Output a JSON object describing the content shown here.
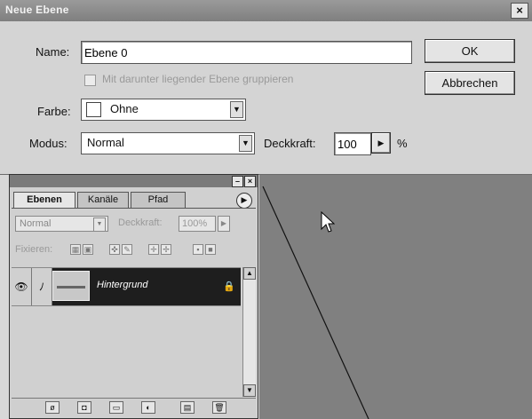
{
  "dialog": {
    "title": "Neue Ebene",
    "close_glyph": "×",
    "name_label": "Name:",
    "name_value": "Ebene 0",
    "group_checkbox_label": "Mit darunter liegender Ebene gruppieren",
    "color_label": "Farbe:",
    "color_value": "Ohne",
    "mode_label": "Modus:",
    "mode_value": "Normal",
    "opacity_label": "Deckkraft:",
    "opacity_value": "100",
    "opacity_unit": "%",
    "ok_label": "OK",
    "cancel_label": "Abbrechen"
  },
  "palette": {
    "tabs": [
      {
        "label": "Ebenen",
        "active": true
      },
      {
        "label": "Kanäle",
        "active": false
      },
      {
        "label": "Pfad",
        "active": false
      }
    ],
    "blend_mode": "Normal",
    "opacity_label": "Deckkraft:",
    "opacity_value": "100%",
    "lock_label": "Fixieren:",
    "layer": {
      "name": "Hintergrund"
    },
    "icons": {
      "visibility": "eye-icon",
      "paint": "brush-icon",
      "lock": "lock-icon",
      "menu": "palette-menu-arrow-icon"
    }
  }
}
